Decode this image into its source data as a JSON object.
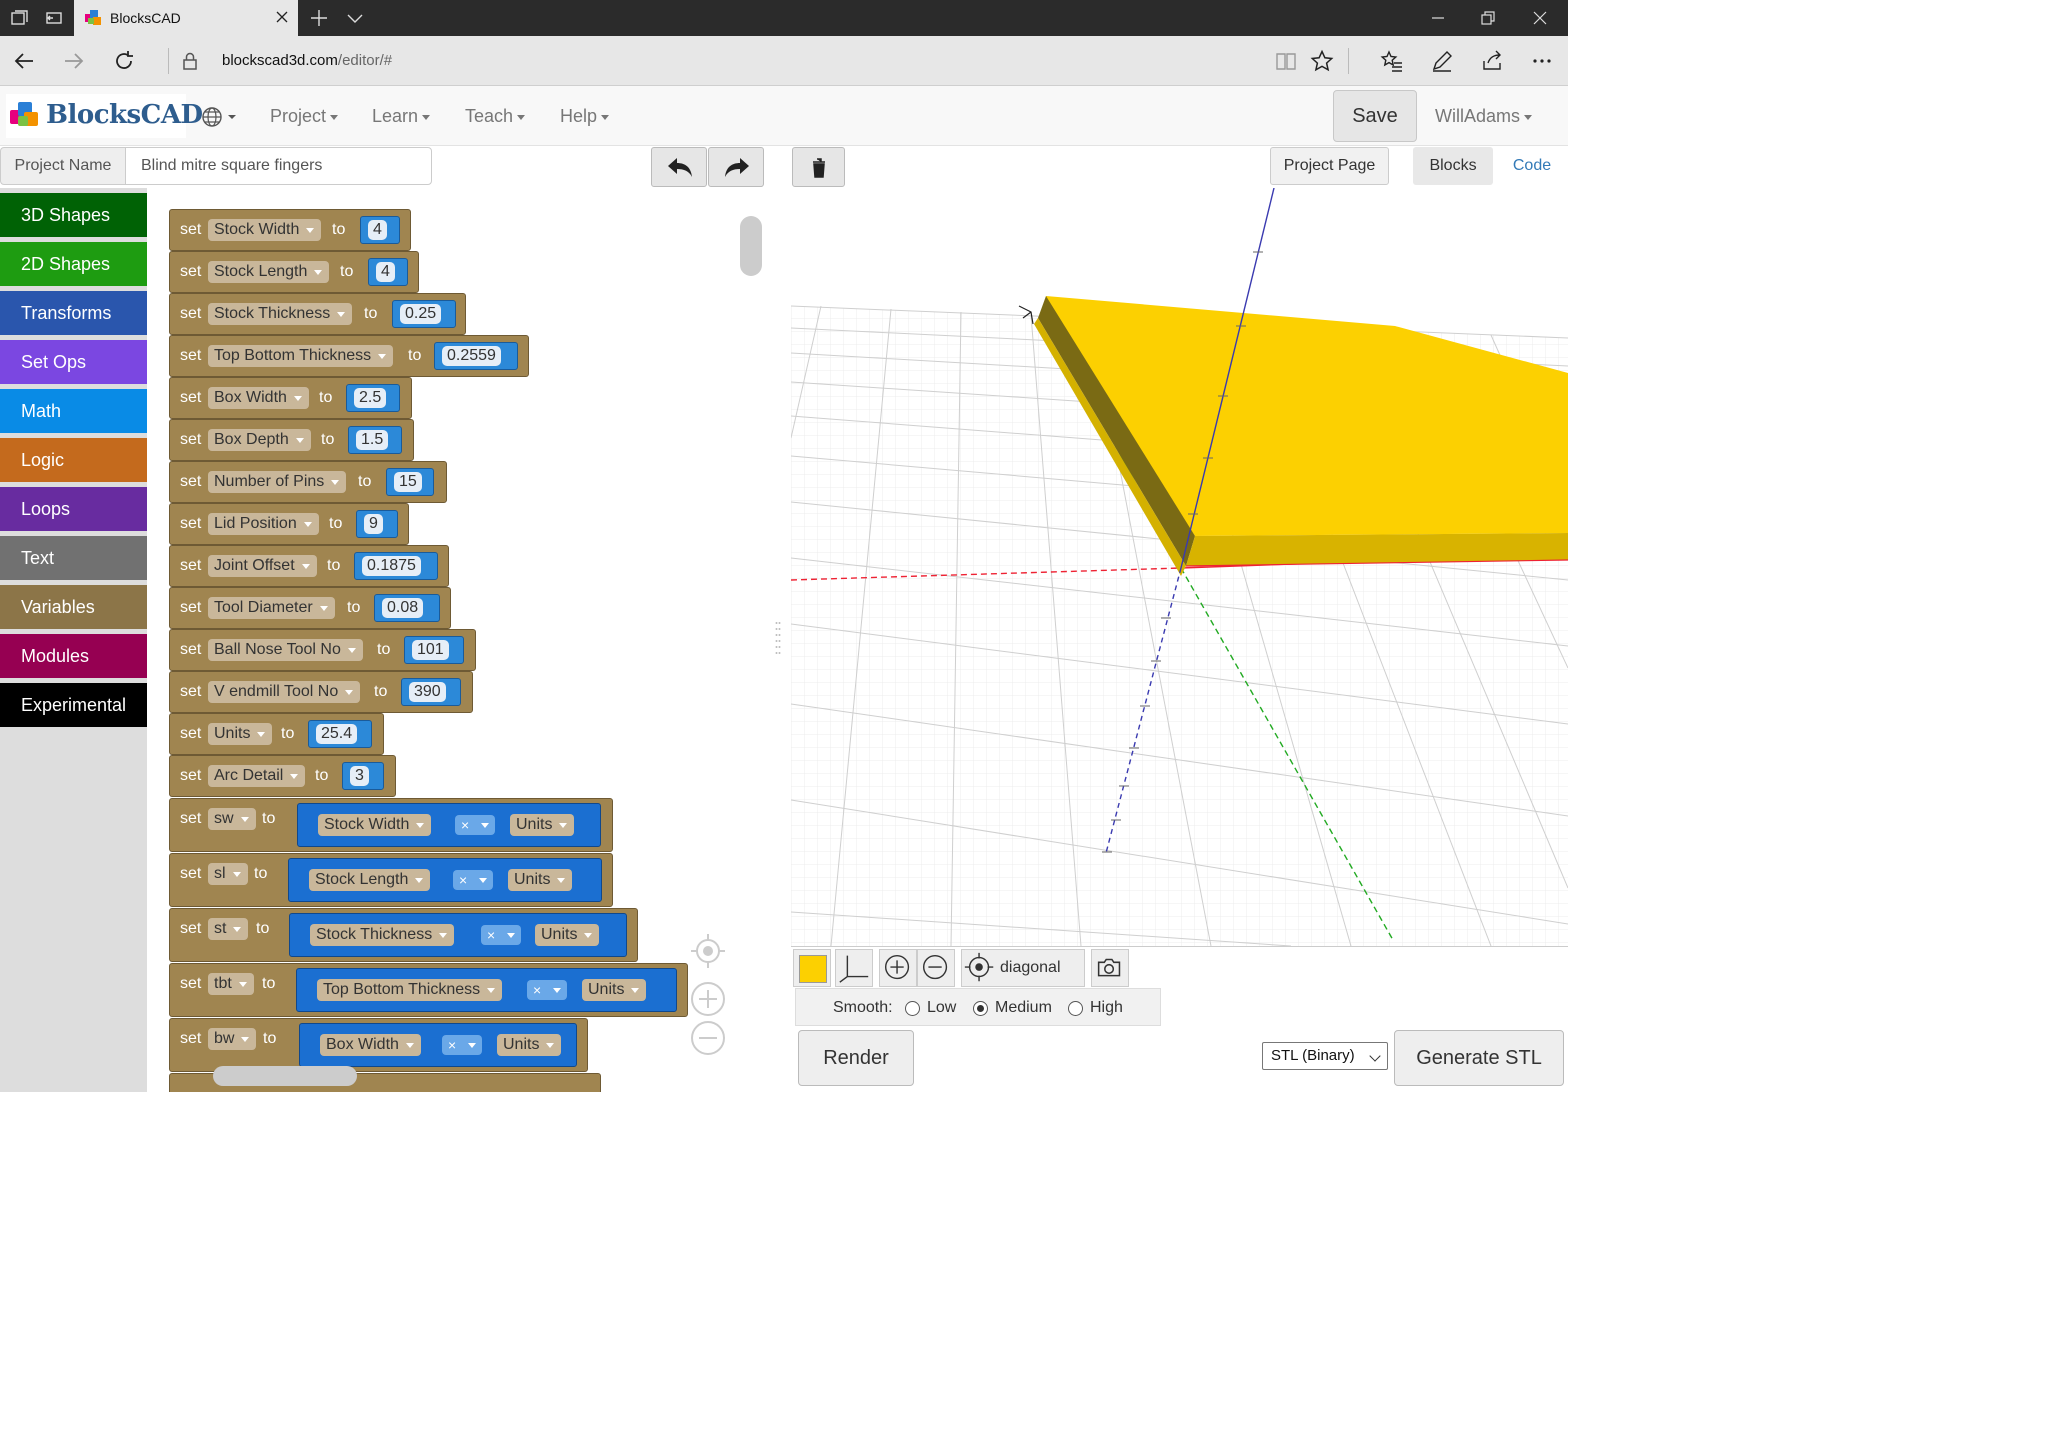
{
  "browser": {
    "tab_title": "BlocksCAD",
    "url_host": "blockscad3d.com",
    "url_path": "/editor/#"
  },
  "header": {
    "logo_text": "BlocksCAD",
    "menus": [
      "Project",
      "Learn",
      "Teach",
      "Help"
    ],
    "save_label": "Save",
    "user_name": "WillAdams"
  },
  "project": {
    "name_label": "Project Name",
    "name_value": "Blind mitre square fingers",
    "project_page_label": "Project Page",
    "tabs": {
      "blocks": "Blocks",
      "code": "Code"
    }
  },
  "toolbox": {
    "categories": [
      {
        "label": "3D Shapes",
        "color": "#006205"
      },
      {
        "label": "2D Shapes",
        "color": "#1e9c11"
      },
      {
        "label": "Transforms",
        "color": "#2a56ad"
      },
      {
        "label": "Set Ops",
        "color": "#7b47e1"
      },
      {
        "label": "Math",
        "color": "#098be6"
      },
      {
        "label": "Logic",
        "color": "#c46a1d"
      },
      {
        "label": "Loops",
        "color": "#682ca0"
      },
      {
        "label": "Text",
        "color": "#717171"
      },
      {
        "label": "Variables",
        "color": "#8c7548"
      },
      {
        "label": "Modules",
        "color": "#960052"
      },
      {
        "label": "Experimental",
        "color": "#000000"
      }
    ]
  },
  "blocks": {
    "set_kw": "set",
    "to_kw": "to",
    "assignments": [
      {
        "var": "Stock Width",
        "value": "4"
      },
      {
        "var": "Stock Length",
        "value": "4"
      },
      {
        "var": "Stock Thickness",
        "value": "0.25"
      },
      {
        "var": "Top Bottom Thickness",
        "value": "0.2559"
      },
      {
        "var": "Box Width",
        "value": "2.5"
      },
      {
        "var": "Box Depth",
        "value": "1.5"
      },
      {
        "var": "Number of Pins",
        "value": "15"
      },
      {
        "var": "Lid Position",
        "value": "9"
      },
      {
        "var": "Joint Offset",
        "value": "0.1875"
      },
      {
        "var": "Tool Diameter",
        "value": "0.08"
      },
      {
        "var": "Ball Nose Tool No",
        "value": "101"
      },
      {
        "var": "V endmill Tool No",
        "value": "390"
      },
      {
        "var": "Units",
        "value": "25.4"
      },
      {
        "var": "Arc Detail",
        "value": "3"
      }
    ],
    "products": [
      {
        "var": "sw",
        "a": "Stock Width",
        "op": "×",
        "b": "Units"
      },
      {
        "var": "sl",
        "a": "Stock Length",
        "op": "×",
        "b": "Units"
      },
      {
        "var": "st",
        "a": "Stock Thickness",
        "op": "×",
        "b": "Units"
      },
      {
        "var": "tbt",
        "a": "Top Bottom Thickness",
        "op": "×",
        "b": "Units"
      },
      {
        "var": "bw",
        "a": "Box Width",
        "op": "×",
        "b": "Units"
      }
    ]
  },
  "viewer": {
    "part_color": "#fcd001",
    "view_name": "diagonal",
    "smooth_label": "Smooth:",
    "smooth_options": [
      "Low",
      "Medium",
      "High"
    ],
    "smooth_selected": "Medium",
    "render_label": "Render",
    "format_value": "STL (Binary)",
    "generate_label": "Generate STL"
  }
}
